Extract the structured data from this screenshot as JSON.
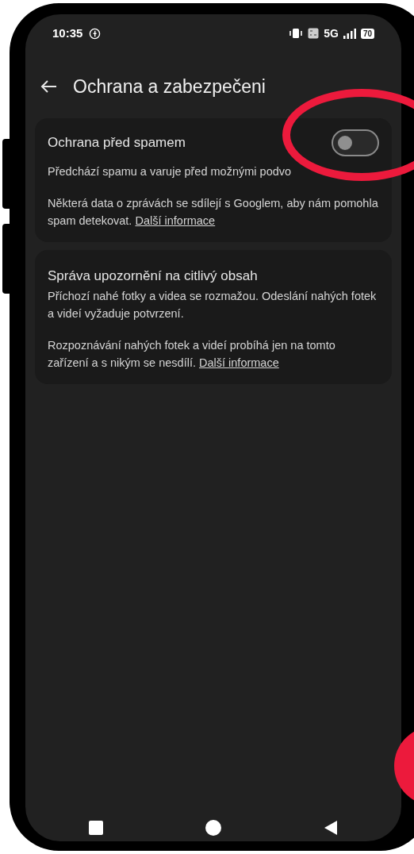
{
  "status_bar": {
    "time": "10:35",
    "network": "5G",
    "battery": "70"
  },
  "header": {
    "title": "Ochrana a zabezpečeni"
  },
  "cards": [
    {
      "kind": "toggle",
      "title": "Ochrana před spamem",
      "on": false,
      "description": "Předchází spamu a varuje před možnými podvo",
      "note": "Některá data o zprávách se sdílejí s Googlem, aby nám pomohla spam detekovat.",
      "link": "Další informace"
    },
    {
      "kind": "plain",
      "title": "Správa upozornění na citlivý obsah",
      "description": "Příchozí nahé fotky a videa se rozmažou. Odeslání nahých fotek a videí vyžaduje potvrzení.",
      "note": "Rozpoznávání nahých fotek a videí probíhá jen na tomto zařízení a s nikým se nesdílí.",
      "link": "Další informace"
    }
  ]
}
